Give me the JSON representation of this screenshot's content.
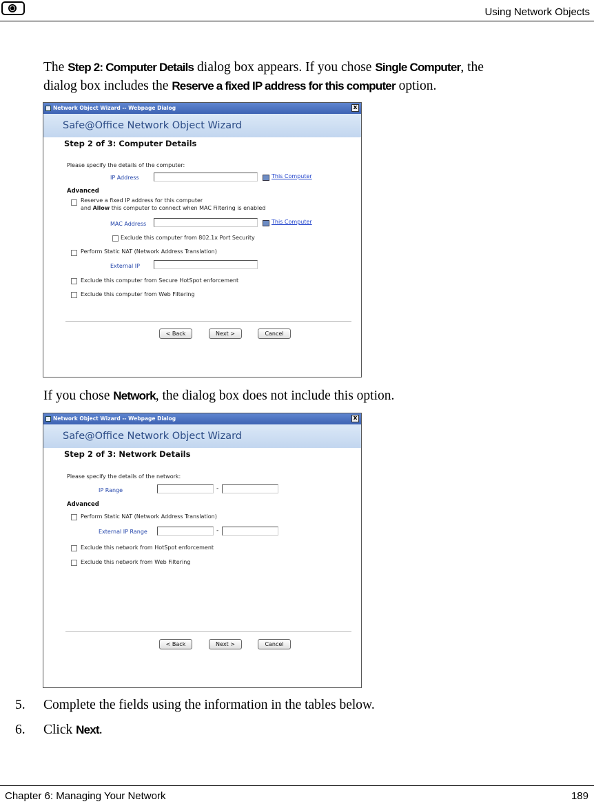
{
  "header": {
    "title": "Using Network Objects",
    "logo_icon": "logo-icon"
  },
  "intro": {
    "t1": "The ",
    "b1": "Step 2: Computer Details",
    "t2": " dialog box appears. If you chose ",
    "b2": "Single Computer",
    "t3": ", the",
    "t4": "dialog box includes the ",
    "b3": "Reserve a fixed IP address for this computer",
    "t5": " option."
  },
  "dialog1": {
    "window_title": "Network Object Wizard -- Webpage Dialog",
    "close": "x",
    "banner": "Safe@Office Network Object Wizard",
    "step_title": "Step 2 of 3: Computer Details",
    "instructions": "Please specify the details of the computer:",
    "ip_label": "IP Address",
    "this_computer": "This Computer",
    "advanced": "Advanced",
    "reserve_line1": "Reserve a fixed IP address for this computer",
    "reserve_line2_a": "and ",
    "reserve_line2_b": "Allow",
    "reserve_line2_c": " this computer to connect when MAC Filtering is enabled",
    "mac_label": "MAC Address",
    "this_computer2": "This Computer",
    "exclude_8021x": "Exclude this computer from 802.1x Port Security",
    "static_nat": "Perform Static NAT (Network Address Translation)",
    "external_ip": "External IP",
    "exclude_hotspot": "Exclude this computer from Secure HotSpot enforcement",
    "exclude_web": "Exclude this computer from Web Filtering",
    "back": "< Back",
    "next": "Next >",
    "cancel": "Cancel"
  },
  "mid": {
    "t1": "If you chose ",
    "b1": "Network",
    "t2": ", the dialog box does not include this option."
  },
  "dialog2": {
    "window_title": "Network Object Wizard -- Webpage Dialog",
    "close": "x",
    "banner": "Safe@Office Network Object Wizard",
    "step_title": "Step 2 of 3: Network Details",
    "instructions": "Please specify the details of the network:",
    "ip_range": "IP Range",
    "advanced": "Advanced",
    "static_nat": "Perform Static NAT (Network Address Translation)",
    "external_ip_range": "External IP Range",
    "exclude_hotspot": "Exclude this network from HotSpot enforcement",
    "exclude_web": "Exclude this network from Web Filtering",
    "dash": "-",
    "back": "< Back",
    "next": "Next >",
    "cancel": "Cancel"
  },
  "steps": [
    {
      "num": "5.",
      "text": "Complete the fields using the information in the tables below."
    },
    {
      "num": "6.",
      "pre": "Click ",
      "bold": "Next",
      "post": "."
    }
  ],
  "footer": {
    "left": "Chapter 6: Managing Your Network",
    "right": "189"
  }
}
